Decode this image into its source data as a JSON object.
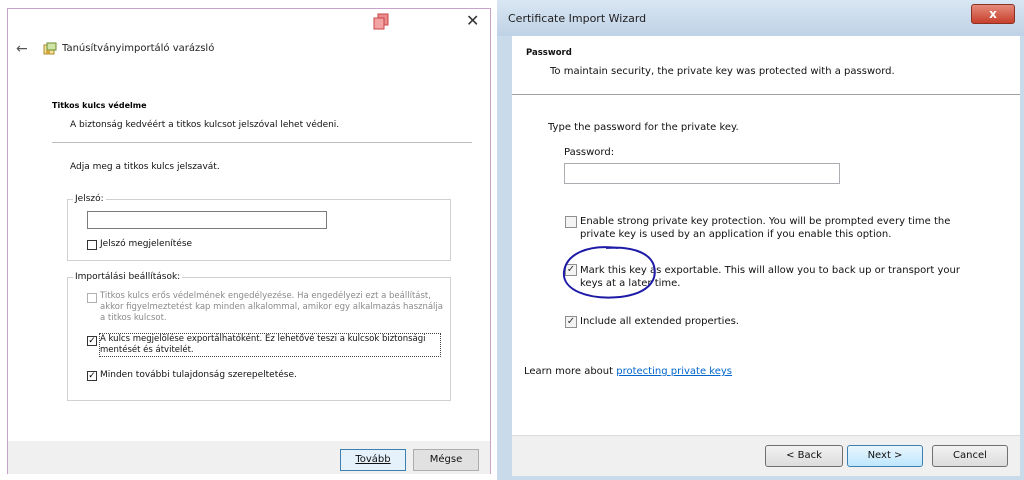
{
  "left_dialog": {
    "title": "Tanúsítványimportáló varázsló",
    "close_glyph": "✕",
    "back_glyph": "←",
    "header": "Titkos kulcs védelme",
    "subheader": "A biztonság kedvéért a titkos kulcsot jelszóval lehet védeni.",
    "prompt": "Adja meg a titkos kulcs jelszavát.",
    "password_group_label": "Jelszó:",
    "password_value": "",
    "show_password_label": "Jelszó megjelenítése",
    "show_password_checked": false,
    "import_group_label": "Importálási beállítások:",
    "options": [
      {
        "label": "Titkos kulcs erős védelmének engedélyezése. Ha engedélyezi ezt a beállítást, akkor figyelmeztetést kap minden alkalommal, amikor egy alkalmazás használja a titkos kulcsot.",
        "checked": false,
        "enabled": false
      },
      {
        "label": "A kulcs megjelölése exportálhatóként. Ez lehetővé teszi a kulcsok biztonsági mentését és átvitelét.",
        "checked": true,
        "enabled": true
      },
      {
        "label": "Minden további tulajdonság szerepeltetése.",
        "checked": true,
        "enabled": true
      }
    ],
    "next_button": "Tovább",
    "cancel_button": "Mégse"
  },
  "right_dialog": {
    "window_title": "Certificate Import Wizard",
    "close_glyph": "x",
    "header": "Password",
    "subheader": "To maintain security, the private key was protected with a password.",
    "prompt": "Type the password for the private key.",
    "password_label": "Password:",
    "password_value": "",
    "options": [
      {
        "label": "Enable strong private key protection. You will be prompted every time the private key is used by an application if you enable this option.",
        "checked": false
      },
      {
        "label": "Mark this key as exportable. This will allow you to back up or transport your keys at a later time.",
        "checked": true
      },
      {
        "label": "Include all extended properties.",
        "checked": true
      }
    ],
    "learn_more_prefix": "Learn more about ",
    "learn_more_link": "protecting private keys",
    "back_button": "< Back",
    "next_button": "Next >",
    "cancel_button": "Cancel",
    "annotation_color": "#1d1aa8"
  }
}
